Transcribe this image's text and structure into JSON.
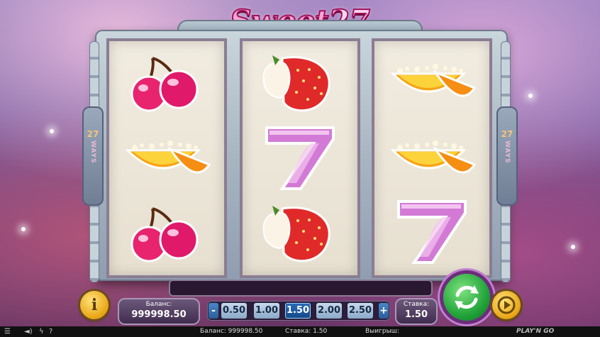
{
  "game": {
    "title": "Sweet",
    "title_number": "27"
  },
  "ways": {
    "number": "27",
    "word": "WAYS"
  },
  "reels": [
    [
      "cherry",
      "orange",
      "cherry"
    ],
    [
      "strawberry",
      "seven",
      "strawberry"
    ],
    [
      "orange",
      "orange",
      "seven"
    ]
  ],
  "controls": {
    "info_label": "i",
    "balance_label": "Баланс:",
    "balance_value": "999998.50",
    "minus_label": "-",
    "plus_label": "+",
    "bets": [
      "0.50",
      "1.00",
      "1.50",
      "2.00",
      "2.50"
    ],
    "selected_bet": "1.50",
    "stake_label": "Ставка:",
    "stake_value": "1.50"
  },
  "status_bar": {
    "balance": "Баланс: 999998.50",
    "stake": "Ставка: 1.50",
    "win": "Выигрыш:",
    "brand": "PLAY'N GO"
  },
  "icons": [
    "menu-icon",
    "sound-icon",
    "turbo-icon",
    "help-icon",
    "spin-icon",
    "autoplay-icon"
  ]
}
